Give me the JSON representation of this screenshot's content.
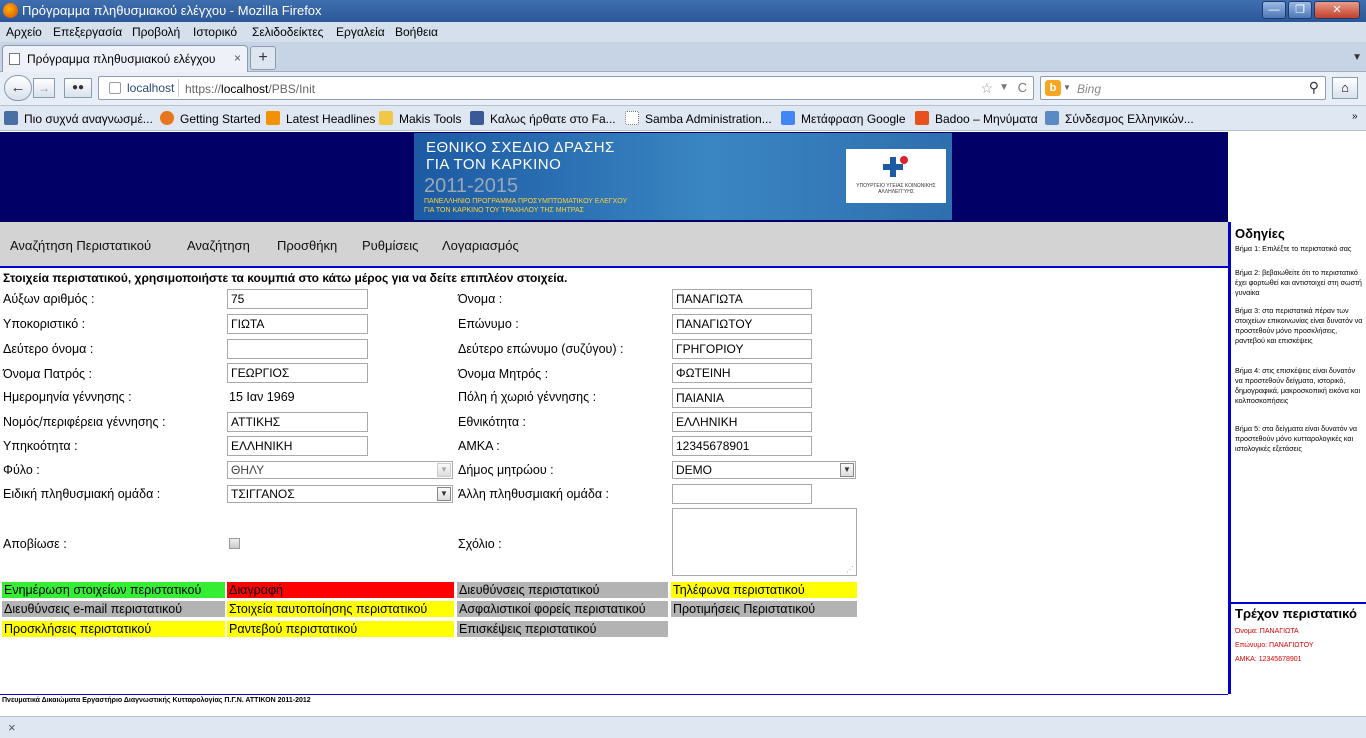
{
  "window": {
    "title": "Πρόγραμμα πληθυσμιακού ελέγχου - Mozilla Firefox",
    "min": "—",
    "max": "❐",
    "close": "✕"
  },
  "menu": [
    "Αρχείο",
    "Επεξεργασία",
    "Προβολή",
    "Ιστορικό",
    "Σελιδοδείκτες",
    "Εργαλεία",
    "Βοήθεια"
  ],
  "tab": {
    "label": "Πρόγραμμα πληθυσμιακού ελέγχου",
    "close": "×",
    "new": "+"
  },
  "nav": {
    "back": "←",
    "forward": "→",
    "host": "localhost",
    "url_prefix": "https://",
    "url_host": "localhost",
    "url_path": "/PBS/Init",
    "star": "☆",
    "drop": "▼",
    "reload": "C",
    "search_engine": "b",
    "search_placeholder": "Bing",
    "search_glass": "⚲",
    "home": "⌂"
  },
  "bookmarks": [
    {
      "label": "Πιο συχνά αναγνωσμέ...",
      "color": "#4a6fa5"
    },
    {
      "label": "Getting Started",
      "color": "#e8761c"
    },
    {
      "label": "Latest Headlines",
      "color": "#f29200"
    },
    {
      "label": "Makis Tools",
      "color": "#f0c846"
    },
    {
      "label": "Καλως ήρθατε στο Fa...",
      "color": "#3b5998"
    },
    {
      "label": "Samba Administration...",
      "color": "#ffffff"
    },
    {
      "label": "Μετάφραση Google",
      "color": "#4285f4"
    },
    {
      "label": "Badoo – Μηνύματα",
      "color": "#e8501e"
    },
    {
      "label": "Σύνδεσμος Ελληνικών...",
      "color": "#5a8ac6"
    }
  ],
  "banner": {
    "line1": "ΕΘΝΙΚΟ ΣΧΕΔΙΟ ΔΡΑΣΗΣ",
    "line2": "ΓΙΑ ΤΟΝ ΚΑΡΚΙΝΟ",
    "years": "2011-2015",
    "sub1": "ΠΑΝΕΛΛΗΝΙΟ ΠΡΟΓΡΑΜΜΑ ΠΡΟΣΥΜΠΤΩΜΑΤΙΚΟΥ ΕΛΕΓΧΟΥ",
    "sub2": "ΓΙΑ ΤΟΝ ΚΑΡΚΙΝΟ ΤΟΥ ΤΡΑΧΗΛΟΥ ΤΗΣ ΜΗΤΡΑΣ",
    "logo_text": "ΥΠΟΥΡΓΕΙΟ ΥΓΕΙΑΣ ΚΟΙΝΩΝΙΚΗΣ ΑΛΛΗΛΕΓΓΥΗΣ"
  },
  "navmenu": [
    "Αναζήτηση Περιστατικού",
    "Αναζήτηση",
    "Προσθήκη",
    "Ρυθμίσεις",
    "Λογαριασμός"
  ],
  "intro": "Στοιχεία περιστατικού, χρησιμοποιήστε τα κουμπιά στο κάτω μέρος για να δείτε επιπλέον στοιχεία.",
  "form": {
    "serial_label": "Αύξων αριθμός :",
    "serial": "75",
    "firstname_label": "Όνομα :",
    "firstname": "ΠΑΝΑΓΙΩΤΑ",
    "nickname_label": "Υποκοριστικό :",
    "nickname": "ΓΙΩΤΑ",
    "surname_label": "Επώνυμο :",
    "surname": "ΠΑΝΑΓΙΩΤΟΥ",
    "middle_label": "Δεύτερο όνομα :",
    "middle": "",
    "second_surname_label": "Δεύτερο επώνυμο (συζύγου) :",
    "second_surname": "ΓΡΗΓΟΡΙΟΥ",
    "father_label": "Όνομα Πατρός :",
    "father": "ΓΕΩΡΓΙΟΣ",
    "mother_label": "Όνομα Μητρός :",
    "mother": "ΦΩΤΕΙΝΗ",
    "birthdate_label": "Ημερομηνία γέννησης :",
    "birthdate": "15 Ιαν 1969",
    "birthcity_label": "Πόλη ή χωριό γέννησης :",
    "birthcity": "ΠΑΙΑΝΙΑ",
    "birthregion_label": "Νομός/περιφέρεια γέννησης :",
    "birthregion": "ΑΤΤΙΚΗΣ",
    "ethnicity_label": "Εθνικότητα :",
    "ethnicity": "ΕΛΛΗΝΙΚΗ",
    "citizenship_label": "Υπηκοότητα :",
    "citizenship": "ΕΛΛΗΝΙΚΗ",
    "amka_label": "ΑΜΚΑ :",
    "amka": "12345678901",
    "gender_label": "Φύλο :",
    "gender": "ΘΗΛΥ",
    "municipality_label": "Δήμος μητρώου :",
    "municipality": "DEMO",
    "group_label": "Ειδική πληθυσμιακή ομάδα :",
    "group": "ΤΣΙΓΓΑΝΟΣ",
    "othergroup_label": "Άλλη πληθυσμιακή ομάδα :",
    "othergroup": "",
    "deceased_label": "Αποβίωσε :",
    "comment_label": "Σχόλιο :",
    "arrow": "▼",
    "grip": "⋰"
  },
  "actions": [
    {
      "label": "Ενημέρωση στοιχείων περιστατικού",
      "bg": "#33ee33"
    },
    {
      "label": "Διαγραφή",
      "bg": "#ff0000"
    },
    {
      "label": "Διευθύνσεις περιστατικού",
      "bg": "#b3b3b3"
    },
    {
      "label": "Τηλέφωνα περιστατικού",
      "bg": "#ffff00"
    },
    {
      "label": "Διευθύνσεις e-mail περιστατικού",
      "bg": "#b3b3b3"
    },
    {
      "label": "Στοιχεία ταυτοποίησης περιστατικού",
      "bg": "#ffff00"
    },
    {
      "label": "Ασφαλιστικοί φορείς περιστατικού",
      "bg": "#b3b3b3"
    },
    {
      "label": "Προτιμήσεις Περιστατικού",
      "bg": "#b3b3b3"
    },
    {
      "label": "Προσκλήσεις περιστατικού",
      "bg": "#ffff00"
    },
    {
      "label": "Ραντεβού περιστατικού",
      "bg": "#ffff00"
    },
    {
      "label": "Επισκέψεις περιστατικού",
      "bg": "#b3b3b3"
    }
  ],
  "sidebar": {
    "title": "Οδηγίες",
    "steps": [
      "Βήμα 1: Επιλέξτε το περιστατικό σας",
      "Βήμα 2: βεβαιωθείτε ότι το περιστατικό έχει φορτωθεί και αντιστοιχεί στη σωστή γυναίκα",
      "Βήμα 3: στα περιστατικά πέραν των στοιχείων επικοινωνίας είναι δυνατόν να προστεθούν μόνο προσκλήσεις, ραντεβού και επισκέψεις",
      "Βήμα 4: στις επισκέψεις είναι δυνατόν να προστεθούν δείγματα, ιστορικό, δημογραφικά, μακροσκοπική εικόνα και κολποσκοπήσεις",
      "Βήμα 5: στα δείγματα είναι δυνατόν να προστεθούν μόνο κυτταρολογικές και ιστολογικές εξετάσεις"
    ],
    "current_title": "Τρέχον περιστατικό",
    "current": [
      "Όνομα: ΠΑΝΑΓΙΩΤΑ",
      "Επώνυμο: ΠΑΝΑΓΙΩΤΟΥ",
      "ΑΜΚΑ: 12345678901"
    ]
  },
  "footer": "Πνευματικά Δικαιώματα Εργαστήριο Διαγνωστικής Κυτταρολογίας Π.Γ.Ν. ΑΤΤΙΚΟΝ 2011-2012",
  "status": {
    "close": "×"
  }
}
